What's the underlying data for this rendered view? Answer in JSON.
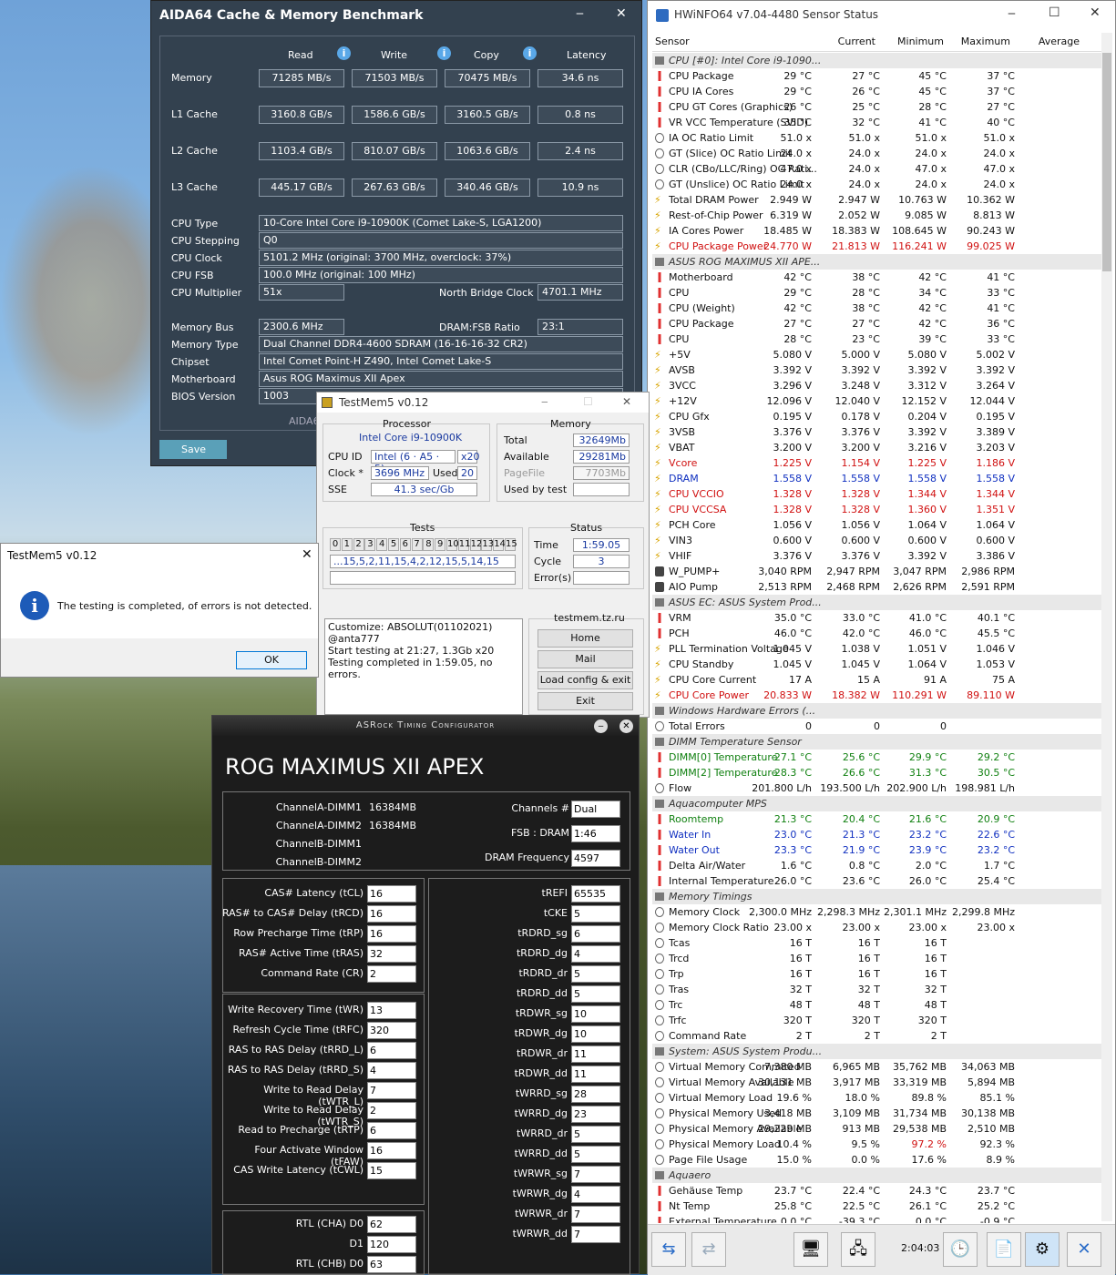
{
  "aida": {
    "title": "AIDA64 Cache & Memory Benchmark",
    "min": "‒",
    "close": "✕",
    "cols": [
      "Read",
      "Write",
      "Copy",
      "Latency"
    ],
    "bench": [
      {
        "label": "Memory",
        "read": "71285 MB/s",
        "write": "71503 MB/s",
        "copy": "70475 MB/s",
        "lat": "34.6 ns"
      },
      {
        "label": "L1 Cache",
        "read": "3160.8 GB/s",
        "write": "1586.6 GB/s",
        "copy": "3160.5 GB/s",
        "lat": "0.8 ns"
      },
      {
        "label": "L2 Cache",
        "read": "1103.4 GB/s",
        "write": "810.07 GB/s",
        "copy": "1063.6 GB/s",
        "lat": "2.4 ns"
      },
      {
        "label": "L3 Cache",
        "read": "445.17 GB/s",
        "write": "267.63 GB/s",
        "copy": "340.46 GB/s",
        "lat": "10.9 ns"
      }
    ],
    "info": [
      {
        "label": "CPU Type",
        "value": "10-Core Intel Core i9-10900K  (Comet Lake-S, LGA1200)"
      },
      {
        "label": "CPU Stepping",
        "value": "Q0"
      },
      {
        "label": "CPU Clock",
        "value": "5101.2 MHz  (original: 3700 MHz, overclock: 37%)"
      },
      {
        "label": "CPU FSB",
        "value": "100.0 MHz  (original: 100 MHz)"
      }
    ],
    "cpu_mult_label": "CPU Multiplier",
    "cpu_mult": "51x",
    "nb_label": "North Bridge Clock",
    "nb": "4701.1 MHz",
    "membus_label": "Memory Bus",
    "membus": "2300.6 MHz",
    "ratio_label": "DRAM:FSB Ratio",
    "ratio": "23:1",
    "info2": [
      {
        "label": "Memory Type",
        "value": "Dual Channel DDR4-4600 SDRAM  (16-16-16-32 CR2)"
      },
      {
        "label": "Chipset",
        "value": "Intel Comet Point-H Z490, Intel Comet Lake-S"
      },
      {
        "label": "Motherboard",
        "value": "Asus ROG Maximus XII Apex"
      }
    ],
    "bios_label": "BIOS Version",
    "bios": "1003",
    "footer": "AIDA6",
    "save": "Save"
  },
  "tm": {
    "title": "TestMem5 v0.12",
    "proc": "Processor",
    "cpu": "Intel Core i9-10900K",
    "cpuid_l": "CPU ID",
    "cpuid": "Intel  (6 · A5 · 5)",
    "x20": "x20",
    "clock_l": "Clock *",
    "clock": "3696 MHz",
    "used_l": "Used",
    "used": "20",
    "sse_l": "SSE",
    "sse": "41.3 sec/Gb",
    "mem": "Memory",
    "total_l": "Total",
    "total": "32649Mb",
    "avail_l": "Available",
    "avail": "29281Mb",
    "pf_l": "PageFile",
    "pf": "7703Mb",
    "ubt_l": "Used by test",
    "ubt": "",
    "tests": "Tests",
    "tnums": [
      "0",
      "1",
      "2",
      "3",
      "4",
      "5",
      "6",
      "7",
      "8",
      "9",
      "10",
      "11",
      "12",
      "13",
      "14",
      "15"
    ],
    "seq": "...15,5,2,11,15,4,2,12,15,5,14,15",
    "status": "Status",
    "time_l": "Time",
    "time": "1:59.05",
    "cycle_l": "Cycle",
    "cycle": "3",
    "err_l": "Error(s)",
    "err": "",
    "log1": "Customize: ABSOLUT(01102021) @anta777",
    "log2": "Start testing at 21:27, 1.3Gb x20",
    "log3": "Testing completed in 1:59.05, no errors.",
    "site": "testmem.tz.ru",
    "home": "Home",
    "mail": "Mail",
    "load": "Load config & exit",
    "exit": "Exit"
  },
  "dlg": {
    "title": "TestMem5 v0.12",
    "msg": "The testing is completed, of errors is not detected.",
    "ok": "OK"
  },
  "asr": {
    "title": "ASRock Timing Configurator",
    "board": "ROG MAXIMUS XII APEX",
    "dimms": [
      {
        "n": "ChannelA-DIMM1",
        "v": "16384MB"
      },
      {
        "n": "ChannelA-DIMM2",
        "v": "16384MB"
      },
      {
        "n": "ChannelB-DIMM1",
        "v": ""
      },
      {
        "n": "ChannelB-DIMM2",
        "v": ""
      }
    ],
    "ch_l": "Channels #",
    "ch": "Dual",
    "fsb_l": "FSB : DRAM",
    "fsb": "1:46",
    "df_l": "DRAM Frequency",
    "df": "4597",
    "left1": [
      [
        "CAS# Latency (tCL)",
        "16"
      ],
      [
        "RAS# to CAS# Delay (tRCD)",
        "16"
      ],
      [
        "Row Precharge Time (tRP)",
        "16"
      ],
      [
        "RAS# Active Time (tRAS)",
        "32"
      ],
      [
        "Command Rate (CR)",
        "2"
      ]
    ],
    "left2": [
      [
        "Write Recovery Time (tWR)",
        "13"
      ],
      [
        "Refresh Cycle Time (tRFC)",
        "320"
      ],
      [
        "RAS to RAS Delay (tRRD_L)",
        "6"
      ],
      [
        "RAS to RAS Delay (tRRD_S)",
        "4"
      ],
      [
        "Write to Read Delay (tWTR_L)",
        "7"
      ],
      [
        "Write to Read Delay (tWTR_S)",
        "2"
      ],
      [
        "Read to Precharge (tRTP)",
        "6"
      ],
      [
        "Four Activate Window (tFAW)",
        "16"
      ],
      [
        "CAS Write Latency (tCWL)",
        "15"
      ]
    ],
    "left3": [
      [
        "RTL (CHA) D0",
        "62"
      ],
      [
        "D1",
        "120"
      ],
      [
        "RTL (CHB) D0",
        "63"
      ]
    ],
    "right": [
      [
        "tREFI",
        "65535"
      ],
      [
        "tCKE",
        "5"
      ],
      [
        "tRDRD_sg",
        "6"
      ],
      [
        "tRDRD_dg",
        "4"
      ],
      [
        "tRDRD_dr",
        "5"
      ],
      [
        "tRDRD_dd",
        "5"
      ],
      [
        "tRDWR_sg",
        "10"
      ],
      [
        "tRDWR_dg",
        "10"
      ],
      [
        "tRDWR_dr",
        "11"
      ],
      [
        "tRDWR_dd",
        "11"
      ],
      [
        "tWRRD_sg",
        "28"
      ],
      [
        "tWRRD_dg",
        "23"
      ],
      [
        "tWRRD_dr",
        "5"
      ],
      [
        "tWRRD_dd",
        "5"
      ],
      [
        "tWRWR_sg",
        "7"
      ],
      [
        "tWRWR_dg",
        "4"
      ],
      [
        "tWRWR_dr",
        "7"
      ],
      [
        "tWRWR_dd",
        "7"
      ]
    ]
  },
  "hw": {
    "title": "HWiNFO64 v7.04-4480 Sensor Status",
    "cols": [
      "Sensor",
      "Current",
      "Minimum",
      "Maximum",
      "Average"
    ],
    "clock": "2:04:03",
    "rows": [
      [
        "g",
        "CPU [#0]: Intel Core i9-1090..."
      ],
      [
        "t",
        "CPU Package",
        "29 °C",
        "27 °C",
        "45 °C",
        "37 °C"
      ],
      [
        "t",
        "CPU IA Cores",
        "29 °C",
        "26 °C",
        "45 °C",
        "37 °C"
      ],
      [
        "t",
        "CPU GT Cores (Graphics)",
        "26 °C",
        "25 °C",
        "28 °C",
        "27 °C"
      ],
      [
        "t",
        "VR VCC Temperature (SVID)",
        "35 °C",
        "32 °C",
        "41 °C",
        "40 °C"
      ],
      [
        "c",
        "IA OC Ratio Limit",
        "51.0 x",
        "51.0 x",
        "51.0 x",
        "51.0 x"
      ],
      [
        "c",
        "GT (Slice) OC Ratio Limit",
        "24.0 x",
        "24.0 x",
        "24.0 x",
        "24.0 x"
      ],
      [
        "c",
        "CLR (CBo/LLC/Ring) OC Rati...",
        "47.0 x",
        "24.0 x",
        "47.0 x",
        "47.0 x"
      ],
      [
        "c",
        "GT (Unslice) OC Ratio Limit",
        "24.0 x",
        "24.0 x",
        "24.0 x",
        "24.0 x"
      ],
      [
        "v",
        "Total DRAM Power",
        "2.949 W",
        "2.947 W",
        "10.763 W",
        "10.362 W"
      ],
      [
        "v",
        "Rest-of-Chip Power",
        "6.319 W",
        "2.052 W",
        "9.085 W",
        "8.813 W"
      ],
      [
        "v",
        "IA Cores Power",
        "18.485 W",
        "18.383 W",
        "108.645 W",
        "90.243 W"
      ],
      [
        "v",
        "CPU Package Power",
        "24.770 W",
        "21.813 W",
        "116.241 W",
        "99.025 W",
        "red"
      ],
      [
        "g",
        "ASUS ROG MAXIMUS XII APE..."
      ],
      [
        "t",
        "Motherboard",
        "42 °C",
        "38 °C",
        "42 °C",
        "41 °C"
      ],
      [
        "t",
        "CPU",
        "29 °C",
        "28 °C",
        "34 °C",
        "33 °C"
      ],
      [
        "t",
        "CPU (Weight)",
        "42 °C",
        "38 °C",
        "42 °C",
        "41 °C"
      ],
      [
        "t",
        "CPU Package",
        "27 °C",
        "27 °C",
        "42 °C",
        "36 °C"
      ],
      [
        "t",
        "CPU",
        "28 °C",
        "23 °C",
        "39 °C",
        "33 °C"
      ],
      [
        "v",
        "+5V",
        "5.080 V",
        "5.000 V",
        "5.080 V",
        "5.002 V"
      ],
      [
        "v",
        "AVSB",
        "3.392 V",
        "3.392 V",
        "3.392 V",
        "3.392 V"
      ],
      [
        "v",
        "3VCC",
        "3.296 V",
        "3.248 V",
        "3.312 V",
        "3.264 V"
      ],
      [
        "v",
        "+12V",
        "12.096 V",
        "12.040 V",
        "12.152 V",
        "12.044 V"
      ],
      [
        "v",
        "CPU Gfx",
        "0.195 V",
        "0.178 V",
        "0.204 V",
        "0.195 V"
      ],
      [
        "v",
        "3VSB",
        "3.376 V",
        "3.376 V",
        "3.392 V",
        "3.389 V"
      ],
      [
        "v",
        "VBAT",
        "3.200 V",
        "3.200 V",
        "3.216 V",
        "3.203 V"
      ],
      [
        "v",
        "Vcore",
        "1.225 V",
        "1.154 V",
        "1.225 V",
        "1.186 V",
        "red"
      ],
      [
        "v",
        "DRAM",
        "1.558 V",
        "1.558 V",
        "1.558 V",
        "1.558 V",
        "blue"
      ],
      [
        "v",
        "CPU VCCIO",
        "1.328 V",
        "1.328 V",
        "1.344 V",
        "1.344 V",
        "red"
      ],
      [
        "v",
        "CPU VCCSA",
        "1.328 V",
        "1.328 V",
        "1.360 V",
        "1.351 V",
        "red"
      ],
      [
        "v",
        "PCH Core",
        "1.056 V",
        "1.056 V",
        "1.064 V",
        "1.064 V"
      ],
      [
        "v",
        "VIN3",
        "0.600 V",
        "0.600 V",
        "0.600 V",
        "0.600 V"
      ],
      [
        "v",
        "VHIF",
        "3.376 V",
        "3.376 V",
        "3.392 V",
        "3.386 V"
      ],
      [
        "f",
        "W_PUMP+",
        "3,040 RPM",
        "2,947 RPM",
        "3,047 RPM",
        "2,986 RPM"
      ],
      [
        "f",
        "AIO Pump",
        "2,513 RPM",
        "2,468 RPM",
        "2,626 RPM",
        "2,591 RPM"
      ],
      [
        "g",
        "ASUS EC: ASUS System Prod..."
      ],
      [
        "t",
        "VRM",
        "35.0 °C",
        "33.0 °C",
        "41.0 °C",
        "40.1 °C"
      ],
      [
        "t",
        "PCH",
        "46.0 °C",
        "42.0 °C",
        "46.0 °C",
        "45.5 °C"
      ],
      [
        "v",
        "PLL Termination Voltage",
        "1.045 V",
        "1.038 V",
        "1.051 V",
        "1.046 V"
      ],
      [
        "v",
        "CPU Standby",
        "1.045 V",
        "1.045 V",
        "1.064 V",
        "1.053 V"
      ],
      [
        "v",
        "CPU Core Current",
        "17 A",
        "15 A",
        "91 A",
        "75 A"
      ],
      [
        "v",
        "CPU Core Power",
        "20.833 W",
        "18.382 W",
        "110.291 W",
        "89.110 W",
        "red"
      ],
      [
        "g",
        "Windows Hardware Errors (..."
      ],
      [
        "c",
        "Total Errors",
        "0",
        "0",
        "0",
        ""
      ],
      [
        "g",
        "DIMM Temperature Sensor"
      ],
      [
        "t",
        "DIMM[0] Temperature",
        "27.1 °C",
        "25.6 °C",
        "29.9 °C",
        "29.2 °C",
        "green"
      ],
      [
        "t",
        "DIMM[2] Temperature",
        "28.3 °C",
        "26.6 °C",
        "31.3 °C",
        "30.5 °C",
        "green"
      ],
      [
        "c",
        "Flow",
        "201.800 L/h",
        "193.500 L/h",
        "202.900 L/h",
        "198.981 L/h"
      ],
      [
        "g",
        "Aquacomputer MPS"
      ],
      [
        "t",
        "Roomtemp",
        "21.3 °C",
        "20.4 °C",
        "21.6 °C",
        "20.9 °C",
        "green"
      ],
      [
        "t",
        "Water In",
        "23.0 °C",
        "21.3 °C",
        "23.2 °C",
        "22.6 °C",
        "blue"
      ],
      [
        "t",
        "Water Out",
        "23.3 °C",
        "21.9 °C",
        "23.9 °C",
        "23.2 °C",
        "blue"
      ],
      [
        "t",
        "Delta Air/Water",
        "1.6 °C",
        "0.8 °C",
        "2.0 °C",
        "1.7 °C"
      ],
      [
        "t",
        "Internal Temperature",
        "26.0 °C",
        "23.6 °C",
        "26.0 °C",
        "25.4 °C"
      ],
      [
        "g",
        "Memory Timings"
      ],
      [
        "c",
        "Memory Clock",
        "2,300.0 MHz",
        "2,298.3 MHz",
        "2,301.1 MHz",
        "2,299.8 MHz"
      ],
      [
        "c",
        "Memory Clock Ratio",
        "23.00 x",
        "23.00 x",
        "23.00 x",
        "23.00 x"
      ],
      [
        "c",
        "Tcas",
        "16 T",
        "16 T",
        "16 T",
        ""
      ],
      [
        "c",
        "Trcd",
        "16 T",
        "16 T",
        "16 T",
        ""
      ],
      [
        "c",
        "Trp",
        "16 T",
        "16 T",
        "16 T",
        ""
      ],
      [
        "c",
        "Tras",
        "32 T",
        "32 T",
        "32 T",
        ""
      ],
      [
        "c",
        "Trc",
        "48 T",
        "48 T",
        "48 T",
        ""
      ],
      [
        "c",
        "Trfc",
        "320 T",
        "320 T",
        "320 T",
        ""
      ],
      [
        "c",
        "Command Rate",
        "2 T",
        "2 T",
        "2 T",
        ""
      ],
      [
        "g",
        "System: ASUS System Produ..."
      ],
      [
        "c",
        "Virtual Memory Commited",
        "7,380 MB",
        "6,965 MB",
        "35,762 MB",
        "34,063 MB"
      ],
      [
        "c",
        "Virtual Memory Available",
        "30,131 MB",
        "3,917 MB",
        "33,319 MB",
        "5,894 MB"
      ],
      [
        "c",
        "Virtual Memory Load",
        "19.6 %",
        "18.0 %",
        "89.8 %",
        "85.1 %"
      ],
      [
        "c",
        "Physical Memory Used",
        "3,418 MB",
        "3,109 MB",
        "31,734 MB",
        "30,138 MB"
      ],
      [
        "c",
        "Physical Memory Available",
        "29,229 MB",
        "913 MB",
        "29,538 MB",
        "2,510 MB"
      ],
      [
        "c",
        "Physical Memory Load",
        "10.4 %",
        "9.5 %",
        "97.2 %",
        "92.3 %",
        "redmax"
      ],
      [
        "c",
        "Page File Usage",
        "15.0 %",
        "0.0 %",
        "17.6 %",
        "8.9 %"
      ],
      [
        "g",
        "Aquaero"
      ],
      [
        "t",
        "Gehäuse Temp",
        "23.7 °C",
        "22.4 °C",
        "24.3 °C",
        "23.7 °C"
      ],
      [
        "t",
        "Nt Temp",
        "25.8 °C",
        "22.5 °C",
        "26.1 °C",
        "25.2 °C"
      ],
      [
        "t",
        "External Temperature",
        "0.0 °C",
        "-39.3 °C",
        "0.0 °C",
        "-0.9 °C"
      ]
    ]
  }
}
